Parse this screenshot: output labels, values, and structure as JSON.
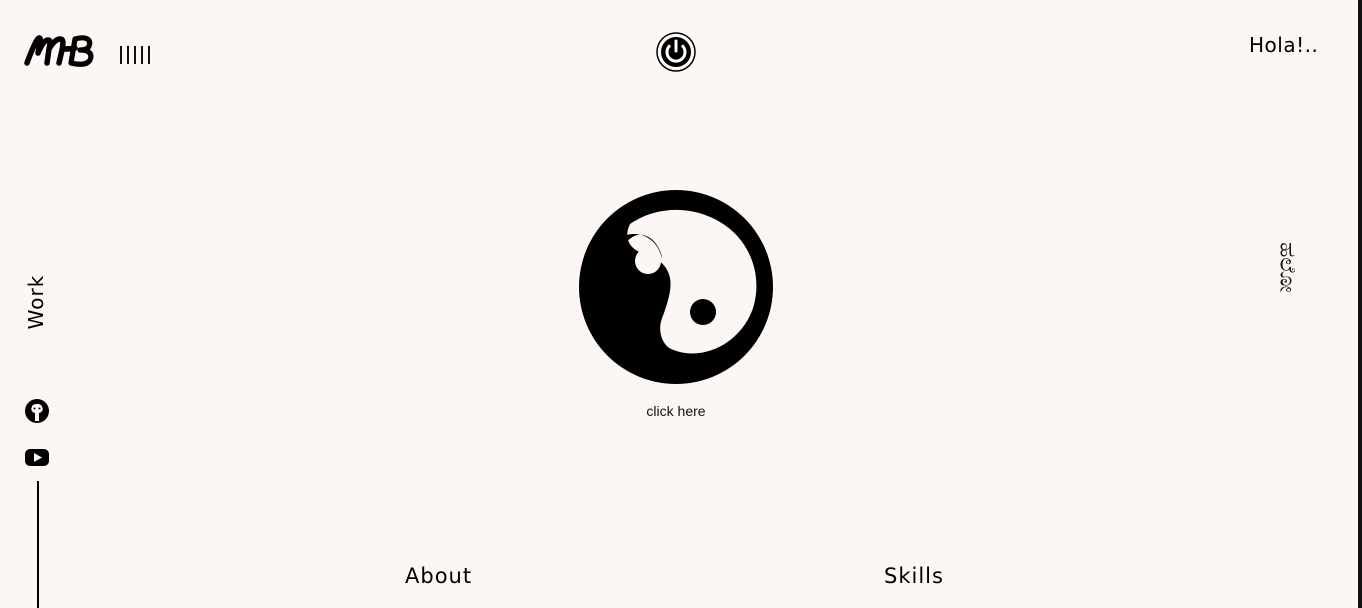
{
  "header": {
    "logo_text": "MB",
    "menu_bars": 5,
    "power_icon": "power-icon",
    "greeting": "Hola!.."
  },
  "center": {
    "main_icon": "yin-yang-icon",
    "caption": "click here"
  },
  "right_nav": {
    "vertical_label": "ಹಲೋ"
  },
  "left_nav": {
    "work_label": "Work",
    "social": [
      {
        "icon": "github-icon"
      },
      {
        "icon": "youtube-icon"
      }
    ]
  },
  "bottom_nav": {
    "about_label": "About",
    "skills_label": "Skills"
  },
  "colors": {
    "background": "#fcf6f4",
    "foreground": "#000000",
    "accent": "#111111"
  }
}
